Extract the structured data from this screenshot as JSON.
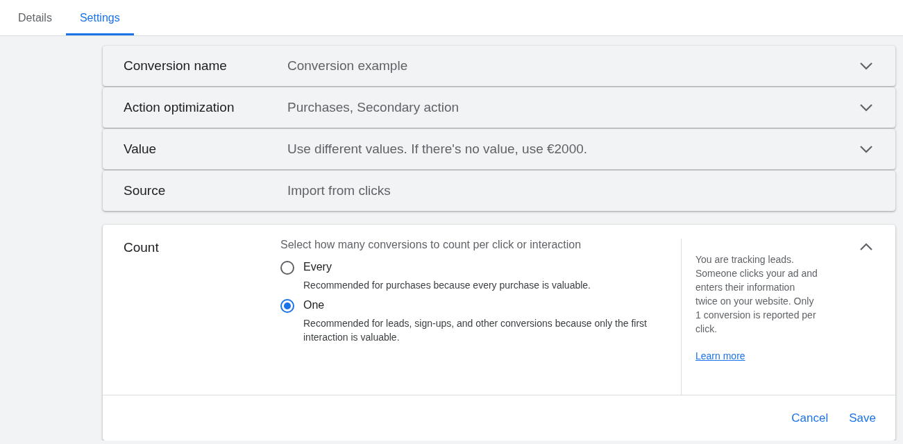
{
  "tabs": [
    {
      "label": "Details",
      "selected": false
    },
    {
      "label": "Settings",
      "selected": true
    }
  ],
  "rows": [
    {
      "label": "Conversion name",
      "value": "Conversion example",
      "expandable": true
    },
    {
      "label": "Action optimization",
      "value": "Purchases, Secondary action",
      "expandable": true
    },
    {
      "label": "Value",
      "value": "Use different values. If there's no value, use €2000.",
      "expandable": true
    },
    {
      "label": "Source",
      "value": "Import from clicks",
      "expandable": false
    }
  ],
  "count": {
    "label": "Count",
    "expanded": true,
    "prompt": "Select how many conversions to count per click or interaction",
    "options": [
      {
        "title": "Every",
        "description": "Recommended for purchases because every purchase is valuable.",
        "selected": false
      },
      {
        "title": "One",
        "description": "Recommended for leads, sign-ups, and other conversions because only the first interaction is valuable.",
        "selected": true
      }
    ],
    "help": {
      "text": "You are tracking leads. Someone clicks your ad and enters their information twice on your website. Only 1 conversion is reported per click.",
      "link": "Learn more"
    },
    "buttons": [
      {
        "label": "Cancel"
      },
      {
        "label": "Save"
      }
    ]
  }
}
